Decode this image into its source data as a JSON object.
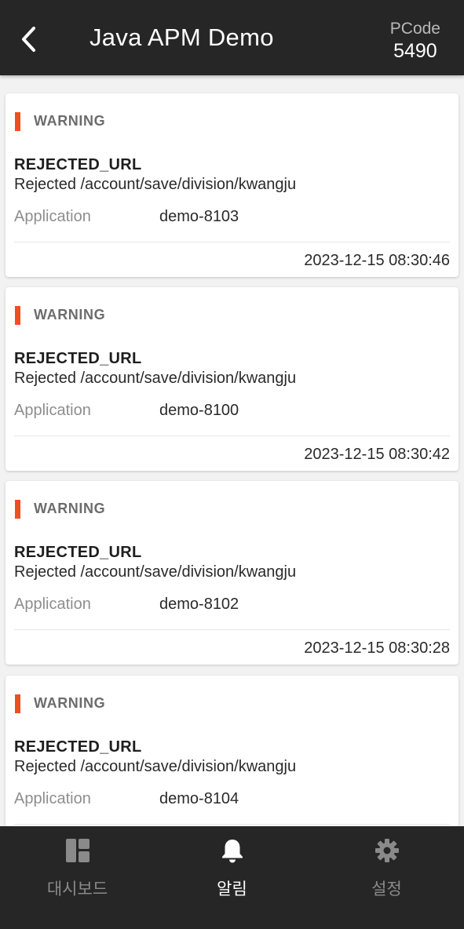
{
  "header": {
    "title": "Java APM Demo",
    "pcode_label": "PCode",
    "pcode_value": "5490"
  },
  "colors": {
    "accent": "#f04e23",
    "header_bg": "#262626",
    "tabbar_bg": "#262626"
  },
  "alerts": [
    {
      "level": "WARNING",
      "name": "REJECTED_URL",
      "message": "Rejected /account/save/division/kwangju",
      "app_label": "Application",
      "app_value": "demo-8103",
      "time": "2023-12-15 08:30:46"
    },
    {
      "level": "WARNING",
      "name": "REJECTED_URL",
      "message": "Rejected /account/save/division/kwangju",
      "app_label": "Application",
      "app_value": "demo-8100",
      "time": "2023-12-15 08:30:42"
    },
    {
      "level": "WARNING",
      "name": "REJECTED_URL",
      "message": "Rejected /account/save/division/kwangju",
      "app_label": "Application",
      "app_value": "demo-8102",
      "time": "2023-12-15 08:30:28"
    },
    {
      "level": "WARNING",
      "name": "REJECTED_URL",
      "message": "Rejected /account/save/division/kwangju",
      "app_label": "Application",
      "app_value": "demo-8104",
      "time": ""
    }
  ],
  "tabs": [
    {
      "label": "대시보드",
      "icon": "dashboard-icon",
      "active": false
    },
    {
      "label": "알림",
      "icon": "bell-icon",
      "active": true
    },
    {
      "label": "설정",
      "icon": "gear-icon",
      "active": false
    }
  ]
}
